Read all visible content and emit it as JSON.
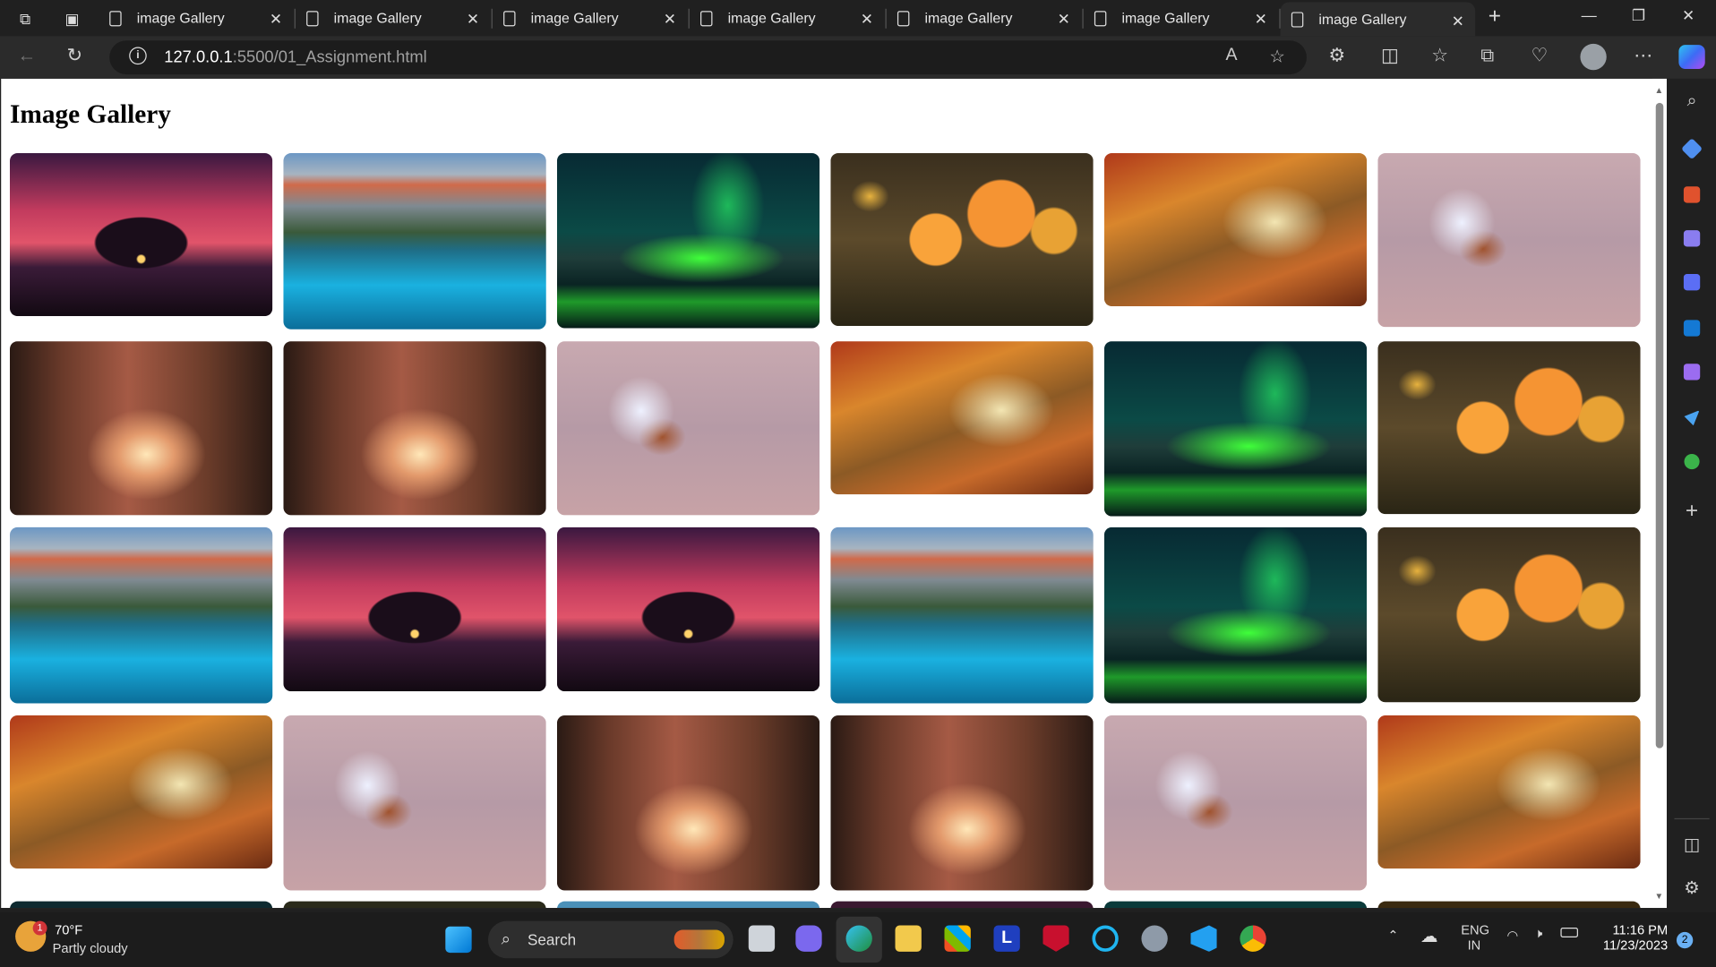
{
  "browser": {
    "tabs": [
      {
        "label": "image Gallery"
      },
      {
        "label": "image Gallery"
      },
      {
        "label": "image Gallery"
      },
      {
        "label": "image Gallery"
      },
      {
        "label": "image Gallery"
      },
      {
        "label": "image Gallery"
      },
      {
        "label": "image Gallery"
      }
    ],
    "url_host": "127.0.0.1",
    "url_rest": ":5500/01_Assignment.html"
  },
  "page": {
    "title": "Image Gallery",
    "images": [
      {
        "subject": "tree silhouette at sunset"
      },
      {
        "subject": "mountain lake"
      },
      {
        "subject": "northern lights"
      },
      {
        "subject": "orange flowers with butterfly"
      },
      {
        "subject": "autumn forest path"
      },
      {
        "subject": "bird with berries"
      },
      {
        "subject": "misty forest"
      },
      {
        "subject": "misty forest"
      },
      {
        "subject": "bird with berries"
      },
      {
        "subject": "autumn forest path"
      },
      {
        "subject": "northern lights"
      },
      {
        "subject": "orange flowers with butterfly"
      },
      {
        "subject": "mountain lake"
      },
      {
        "subject": "tree silhouette at sunset"
      },
      {
        "subject": "tree silhouette at sunset"
      },
      {
        "subject": "mountain lake"
      },
      {
        "subject": "northern lights"
      },
      {
        "subject": "orange flowers with butterfly"
      },
      {
        "subject": "autumn forest path"
      },
      {
        "subject": "bird with berries"
      },
      {
        "subject": "misty forest"
      },
      {
        "subject": "misty forest"
      },
      {
        "subject": "bird with berries"
      },
      {
        "subject": "autumn forest path"
      }
    ]
  },
  "taskbar": {
    "weather_badge": "1",
    "temperature": "70°F",
    "condition": "Partly cloudy",
    "search_label": "Search",
    "lang_1": "ENG",
    "lang_2": "IN",
    "time": "11:16 PM",
    "date": "11/23/2023",
    "notification_count": "2"
  },
  "colors": {
    "chrome_bg": "#202020",
    "page_bg": "#ffffff",
    "accent": "#0078d4"
  }
}
